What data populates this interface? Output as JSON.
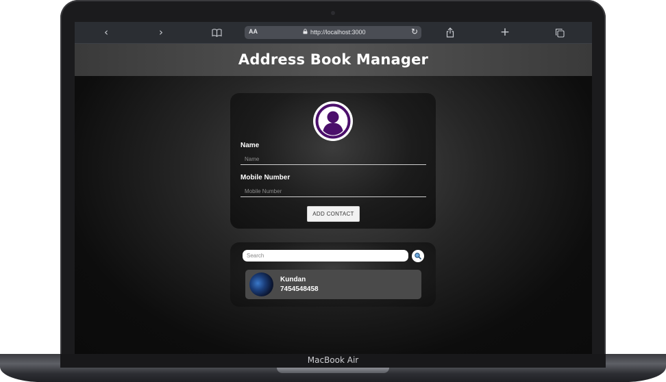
{
  "device": {
    "label": "MacBook Air"
  },
  "browser": {
    "text_size_label": "AA",
    "url": "http://localhost:3000",
    "icons": {
      "back": "chevron-left-icon",
      "forward": "chevron-right-icon",
      "bookmarks": "book-icon",
      "reload": "reload-icon",
      "share": "share-icon",
      "new_tab": "plus-icon",
      "tabs": "tabs-icon"
    }
  },
  "app": {
    "title": "Address Book Manager",
    "form": {
      "name_label": "Name",
      "name_placeholder": "Name",
      "name_value": "",
      "mobile_label": "Mobile Number",
      "mobile_placeholder": "Mobile Number",
      "mobile_value": "",
      "add_button_label": "ADD CONTACT",
      "avatar_icon": "user-circle-icon"
    },
    "search": {
      "placeholder": "Search",
      "value": "",
      "icon": "search-icon"
    },
    "contacts": [
      {
        "name": "Kundan",
        "phone": "7454548458"
      }
    ]
  },
  "colors": {
    "accent_purple": "#4b0f6b",
    "header_bg": "#4a4a4a",
    "card_bg": "#1c1c1c",
    "contact_bg": "#4a4a4a"
  }
}
